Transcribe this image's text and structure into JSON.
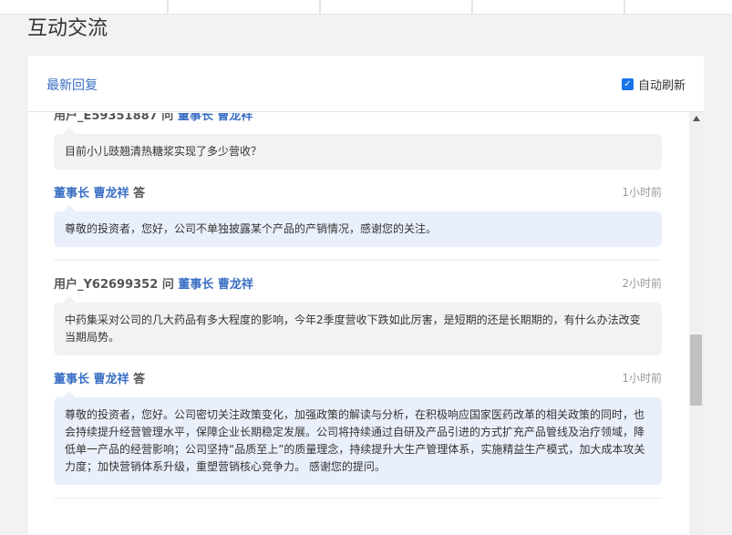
{
  "page_title": "互动交流",
  "tabs": {
    "latest_label": "最新回复"
  },
  "auto_refresh": {
    "label": "自动刷新",
    "checked": true
  },
  "feed": [
    {
      "asker": "用户_E59351887",
      "ask_verb": "问",
      "target": "董事长 曹龙祥",
      "question": "目前小儿豉翘清热糖浆实现了多少营收？",
      "answerer": "董事长 曹龙祥",
      "answer_verb": "答",
      "answer_time": "1小时前",
      "answer": "尊敬的投资者，您好，公司不单独披露某个产品的产销情况，感谢您的关注。"
    },
    {
      "asker": "用户_Y62699352",
      "ask_verb": "问",
      "target": "董事长 曹龙祥",
      "question_time": "2小时前",
      "question": "中药集采对公司的几大药品有多大程度的影响，今年2季度营收下跌如此厉害，是短期的还是长期期的，有什么办法改变当期局势。",
      "answerer": "董事长 曹龙祥",
      "answer_verb": "答",
      "answer_time": "1小时前",
      "answer": "尊敬的投资者，您好。公司密切关注政策变化，加强政策的解读与分析，在积极响应国家医药改革的相关政策的同时，也会持续提升经营管理水平，保障企业长期稳定发展。公司将持续通过自研及产品引进的方式扩充产品管线及治疗领域，降低单一产品的经营影响；公司坚持“品质至上”的质量理念，持续提升大生产管理体系，实施精益生产模式，加大成本攻关力度；加快营销体系升级，重塑营销核心竞争力。 感谢您的提问。"
    }
  ]
}
